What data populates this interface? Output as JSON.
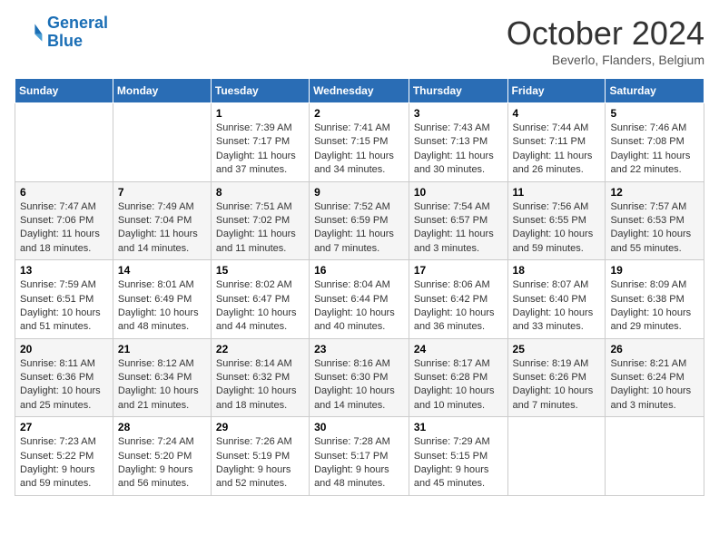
{
  "header": {
    "logo_line1": "General",
    "logo_line2": "Blue",
    "month": "October 2024",
    "location": "Beverlo, Flanders, Belgium"
  },
  "days_of_week": [
    "Sunday",
    "Monday",
    "Tuesday",
    "Wednesday",
    "Thursday",
    "Friday",
    "Saturday"
  ],
  "weeks": [
    [
      {
        "day": "",
        "info": ""
      },
      {
        "day": "",
        "info": ""
      },
      {
        "day": "1",
        "info": "Sunrise: 7:39 AM\nSunset: 7:17 PM\nDaylight: 11 hours and 37 minutes."
      },
      {
        "day": "2",
        "info": "Sunrise: 7:41 AM\nSunset: 7:15 PM\nDaylight: 11 hours and 34 minutes."
      },
      {
        "day": "3",
        "info": "Sunrise: 7:43 AM\nSunset: 7:13 PM\nDaylight: 11 hours and 30 minutes."
      },
      {
        "day": "4",
        "info": "Sunrise: 7:44 AM\nSunset: 7:11 PM\nDaylight: 11 hours and 26 minutes."
      },
      {
        "day": "5",
        "info": "Sunrise: 7:46 AM\nSunset: 7:08 PM\nDaylight: 11 hours and 22 minutes."
      }
    ],
    [
      {
        "day": "6",
        "info": "Sunrise: 7:47 AM\nSunset: 7:06 PM\nDaylight: 11 hours and 18 minutes."
      },
      {
        "day": "7",
        "info": "Sunrise: 7:49 AM\nSunset: 7:04 PM\nDaylight: 11 hours and 14 minutes."
      },
      {
        "day": "8",
        "info": "Sunrise: 7:51 AM\nSunset: 7:02 PM\nDaylight: 11 hours and 11 minutes."
      },
      {
        "day": "9",
        "info": "Sunrise: 7:52 AM\nSunset: 6:59 PM\nDaylight: 11 hours and 7 minutes."
      },
      {
        "day": "10",
        "info": "Sunrise: 7:54 AM\nSunset: 6:57 PM\nDaylight: 11 hours and 3 minutes."
      },
      {
        "day": "11",
        "info": "Sunrise: 7:56 AM\nSunset: 6:55 PM\nDaylight: 10 hours and 59 minutes."
      },
      {
        "day": "12",
        "info": "Sunrise: 7:57 AM\nSunset: 6:53 PM\nDaylight: 10 hours and 55 minutes."
      }
    ],
    [
      {
        "day": "13",
        "info": "Sunrise: 7:59 AM\nSunset: 6:51 PM\nDaylight: 10 hours and 51 minutes."
      },
      {
        "day": "14",
        "info": "Sunrise: 8:01 AM\nSunset: 6:49 PM\nDaylight: 10 hours and 48 minutes."
      },
      {
        "day": "15",
        "info": "Sunrise: 8:02 AM\nSunset: 6:47 PM\nDaylight: 10 hours and 44 minutes."
      },
      {
        "day": "16",
        "info": "Sunrise: 8:04 AM\nSunset: 6:44 PM\nDaylight: 10 hours and 40 minutes."
      },
      {
        "day": "17",
        "info": "Sunrise: 8:06 AM\nSunset: 6:42 PM\nDaylight: 10 hours and 36 minutes."
      },
      {
        "day": "18",
        "info": "Sunrise: 8:07 AM\nSunset: 6:40 PM\nDaylight: 10 hours and 33 minutes."
      },
      {
        "day": "19",
        "info": "Sunrise: 8:09 AM\nSunset: 6:38 PM\nDaylight: 10 hours and 29 minutes."
      }
    ],
    [
      {
        "day": "20",
        "info": "Sunrise: 8:11 AM\nSunset: 6:36 PM\nDaylight: 10 hours and 25 minutes."
      },
      {
        "day": "21",
        "info": "Sunrise: 8:12 AM\nSunset: 6:34 PM\nDaylight: 10 hours and 21 minutes."
      },
      {
        "day": "22",
        "info": "Sunrise: 8:14 AM\nSunset: 6:32 PM\nDaylight: 10 hours and 18 minutes."
      },
      {
        "day": "23",
        "info": "Sunrise: 8:16 AM\nSunset: 6:30 PM\nDaylight: 10 hours and 14 minutes."
      },
      {
        "day": "24",
        "info": "Sunrise: 8:17 AM\nSunset: 6:28 PM\nDaylight: 10 hours and 10 minutes."
      },
      {
        "day": "25",
        "info": "Sunrise: 8:19 AM\nSunset: 6:26 PM\nDaylight: 10 hours and 7 minutes."
      },
      {
        "day": "26",
        "info": "Sunrise: 8:21 AM\nSunset: 6:24 PM\nDaylight: 10 hours and 3 minutes."
      }
    ],
    [
      {
        "day": "27",
        "info": "Sunrise: 7:23 AM\nSunset: 5:22 PM\nDaylight: 9 hours and 59 minutes."
      },
      {
        "day": "28",
        "info": "Sunrise: 7:24 AM\nSunset: 5:20 PM\nDaylight: 9 hours and 56 minutes."
      },
      {
        "day": "29",
        "info": "Sunrise: 7:26 AM\nSunset: 5:19 PM\nDaylight: 9 hours and 52 minutes."
      },
      {
        "day": "30",
        "info": "Sunrise: 7:28 AM\nSunset: 5:17 PM\nDaylight: 9 hours and 48 minutes."
      },
      {
        "day": "31",
        "info": "Sunrise: 7:29 AM\nSunset: 5:15 PM\nDaylight: 9 hours and 45 minutes."
      },
      {
        "day": "",
        "info": ""
      },
      {
        "day": "",
        "info": ""
      }
    ]
  ]
}
